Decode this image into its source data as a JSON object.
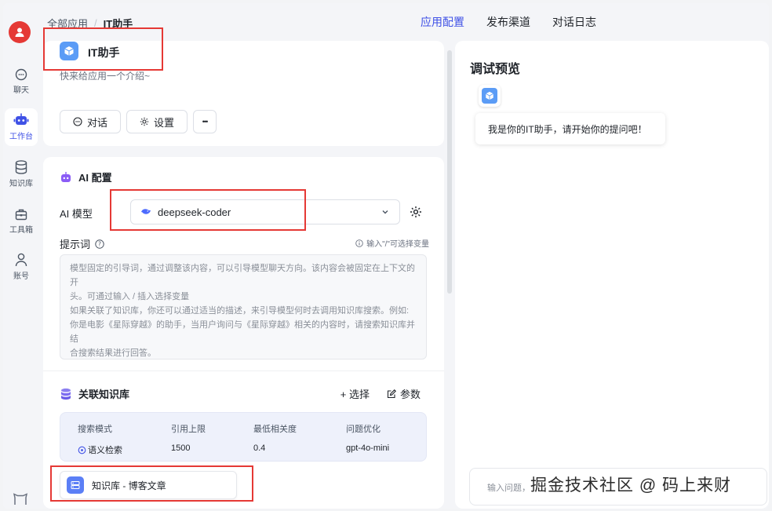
{
  "breadcrumb": {
    "root": "全部应用",
    "separator": "/",
    "current": "IT助手"
  },
  "top_nav": [
    {
      "label": "应用配置",
      "active": true
    },
    {
      "label": "发布渠道",
      "active": false
    },
    {
      "label": "对话日志",
      "active": false
    }
  ],
  "sidebar": {
    "items": [
      {
        "label": "聊天",
        "icon": "chat-icon",
        "active": false
      },
      {
        "label": "工作台",
        "icon": "robot-icon",
        "active": true
      },
      {
        "label": "知识库",
        "icon": "database-icon",
        "active": false
      },
      {
        "label": "工具箱",
        "icon": "toolbox-icon",
        "active": false
      },
      {
        "label": "账号",
        "icon": "user-icon",
        "active": false
      }
    ],
    "bottom_icon": "github-icon"
  },
  "app": {
    "name": "IT助手",
    "intro": "快来给应用一个介绍~",
    "buttons": {
      "chat": "对话",
      "settings": "设置",
      "more": "•••"
    }
  },
  "ai_config": {
    "title": "AI 配置",
    "model_label": "AI 模型",
    "model_value": "deepseek-coder",
    "prompt_label": "提示词",
    "prompt_hint": "输入\"/\"可选择变量",
    "prompt_placeholder_lines": [
      "模型固定的引导词，通过调整该内容，可以引导模型聊天方向。该内容会被固定在上下文的开",
      "头。可通过输入 / 插入选择变量",
      "如果关联了知识库，你还可以通过适当的描述，来引导模型何时去调用知识库搜索。例如:",
      "你是电影《星际穿越》的助手，当用户询问与《星际穿越》相关的内容时，请搜索知识库并结",
      "合搜索结果进行回答。"
    ]
  },
  "knowledge": {
    "title": "关联知识库",
    "select_label": "+ 选择",
    "params_label": "参数",
    "table": {
      "headers": [
        "搜索模式",
        "引用上限",
        "最低相关度",
        "问题优化"
      ],
      "row": [
        "语义检索",
        "1500",
        "0.4",
        "gpt-4o-mini"
      ]
    },
    "item": "知识库 - 博客文章"
  },
  "debug": {
    "title": "调试预览",
    "greeting": "我是你的IT助手，请开始你的提问吧！",
    "input_placeholder": "输入问题，"
  },
  "watermark": "掘金技术社区 @ 码上来财",
  "colors": {
    "accent": "#3f51e6",
    "highlight": "#e53935",
    "avatar": "#e53935",
    "app_icon": "#5b9cf6"
  }
}
